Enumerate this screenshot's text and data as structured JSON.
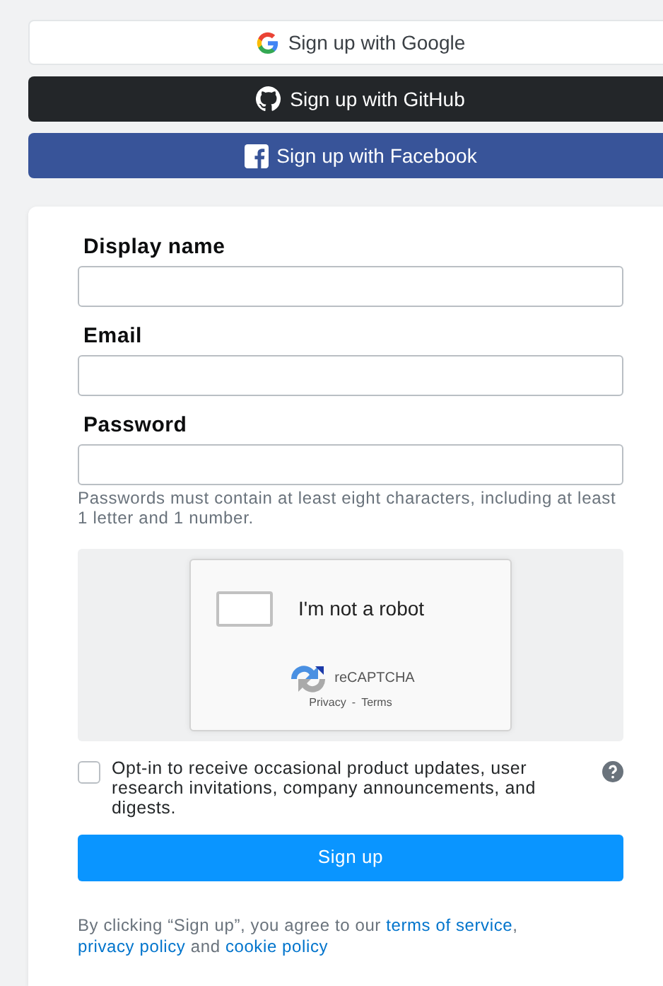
{
  "social_buttons": [
    {
      "kind": "google",
      "label": "Sign up with Google"
    },
    {
      "kind": "github",
      "label": "Sign up with GitHub"
    },
    {
      "kind": "facebook",
      "label": "Sign up with Facebook"
    }
  ],
  "fields": [
    {
      "label": "Display name"
    },
    {
      "label": "Email"
    },
    {
      "label": "Password",
      "hint": "Passwords must contain at least eight characters, including at least 1 letter and 1 number."
    }
  ],
  "captcha": {
    "label": "I'm not a robot",
    "checked": false,
    "brand": "reCAPTCHA",
    "links": [
      "Privacy",
      "Terms"
    ],
    "separator": "-"
  },
  "opt_in": {
    "checked": false,
    "text": "Opt-in to receive occasional product updates, user research invitations, company announcements, and digests."
  },
  "submit": "Sign up",
  "disclaimer": [
    {
      "kind": "text",
      "text": "By clicking “Sign up”, you agree to our "
    },
    {
      "kind": "link",
      "text": "terms of service"
    },
    {
      "kind": "text",
      "text": ", "
    },
    {
      "kind": "link",
      "text": "privacy policy"
    },
    {
      "kind": "text",
      "text": " and "
    },
    {
      "kind": "link",
      "text": "cookie policy"
    }
  ]
}
